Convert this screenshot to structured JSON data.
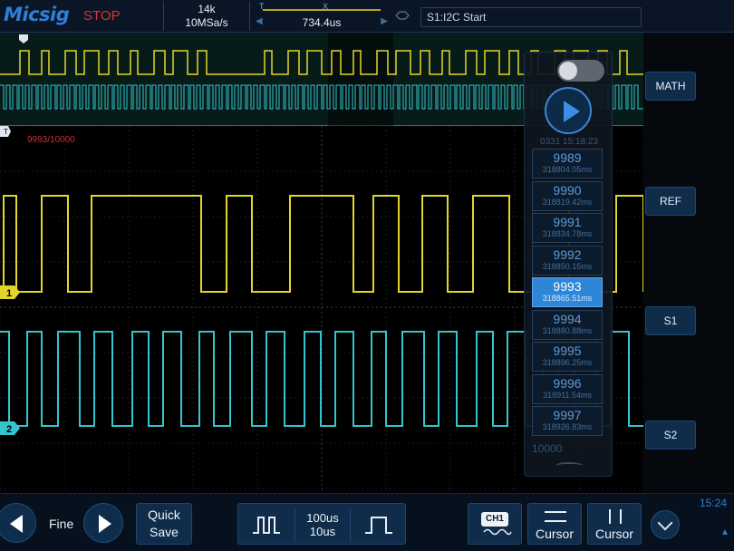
{
  "header": {
    "logo": "Micsig",
    "run_status": "STOP",
    "memory_depth": "14k",
    "sample_rate": "10MSa/s",
    "timebase_position": "734.4us",
    "trigger_info": "S1:I2C Start",
    "pos_marker_t": "T",
    "pos_marker_x": "X"
  },
  "scope": {
    "record_counter": "9993/10000",
    "ch1_label": "1",
    "ch2_label": "2",
    "trig_label": "T",
    "ch1_color": "#e3d62a",
    "ch2_color": "#33c6cf",
    "grid_color": "#2a2f36"
  },
  "segment_panel": {
    "timestamp": "0331 15:18:23",
    "items": [
      {
        "num": "9989",
        "time": "318804.05ms",
        "selected": false
      },
      {
        "num": "9990",
        "time": "318819.42ms",
        "selected": false
      },
      {
        "num": "9991",
        "time": "318834.78ms",
        "selected": false
      },
      {
        "num": "9992",
        "time": "318850.15ms",
        "selected": false
      },
      {
        "num": "9993",
        "time": "318865.51ms",
        "selected": true
      },
      {
        "num": "9994",
        "time": "318880.88ms",
        "selected": false
      },
      {
        "num": "9995",
        "time": "318896.25ms",
        "selected": false
      },
      {
        "num": "9996",
        "time": "318911.54ms",
        "selected": false
      },
      {
        "num": "9997",
        "time": "318926.83ms",
        "selected": false
      }
    ],
    "total": "10000"
  },
  "side_buttons": {
    "math": "MATH",
    "ref": "REF",
    "s1": "S1",
    "s2": "S2"
  },
  "toolbar": {
    "fine_label": "Fine",
    "quick_save_line1": "Quick",
    "quick_save_line2": "Save",
    "width_upper": "100us",
    "width_lower": "10us",
    "ch1_badge": "CH1",
    "cursor1_label": "Cursor",
    "cursor2_label": "Cursor"
  },
  "status": {
    "clock": "15:24"
  },
  "icons": [
    "prev-arrow-icon",
    "next-arrow-icon",
    "pulse-narrow-icon",
    "pulse-wide-icon",
    "play-icon",
    "chevron-down-icon",
    "cursor-horizontal-icon",
    "cursor-vertical-icon",
    "trigger-edge-icon"
  ]
}
